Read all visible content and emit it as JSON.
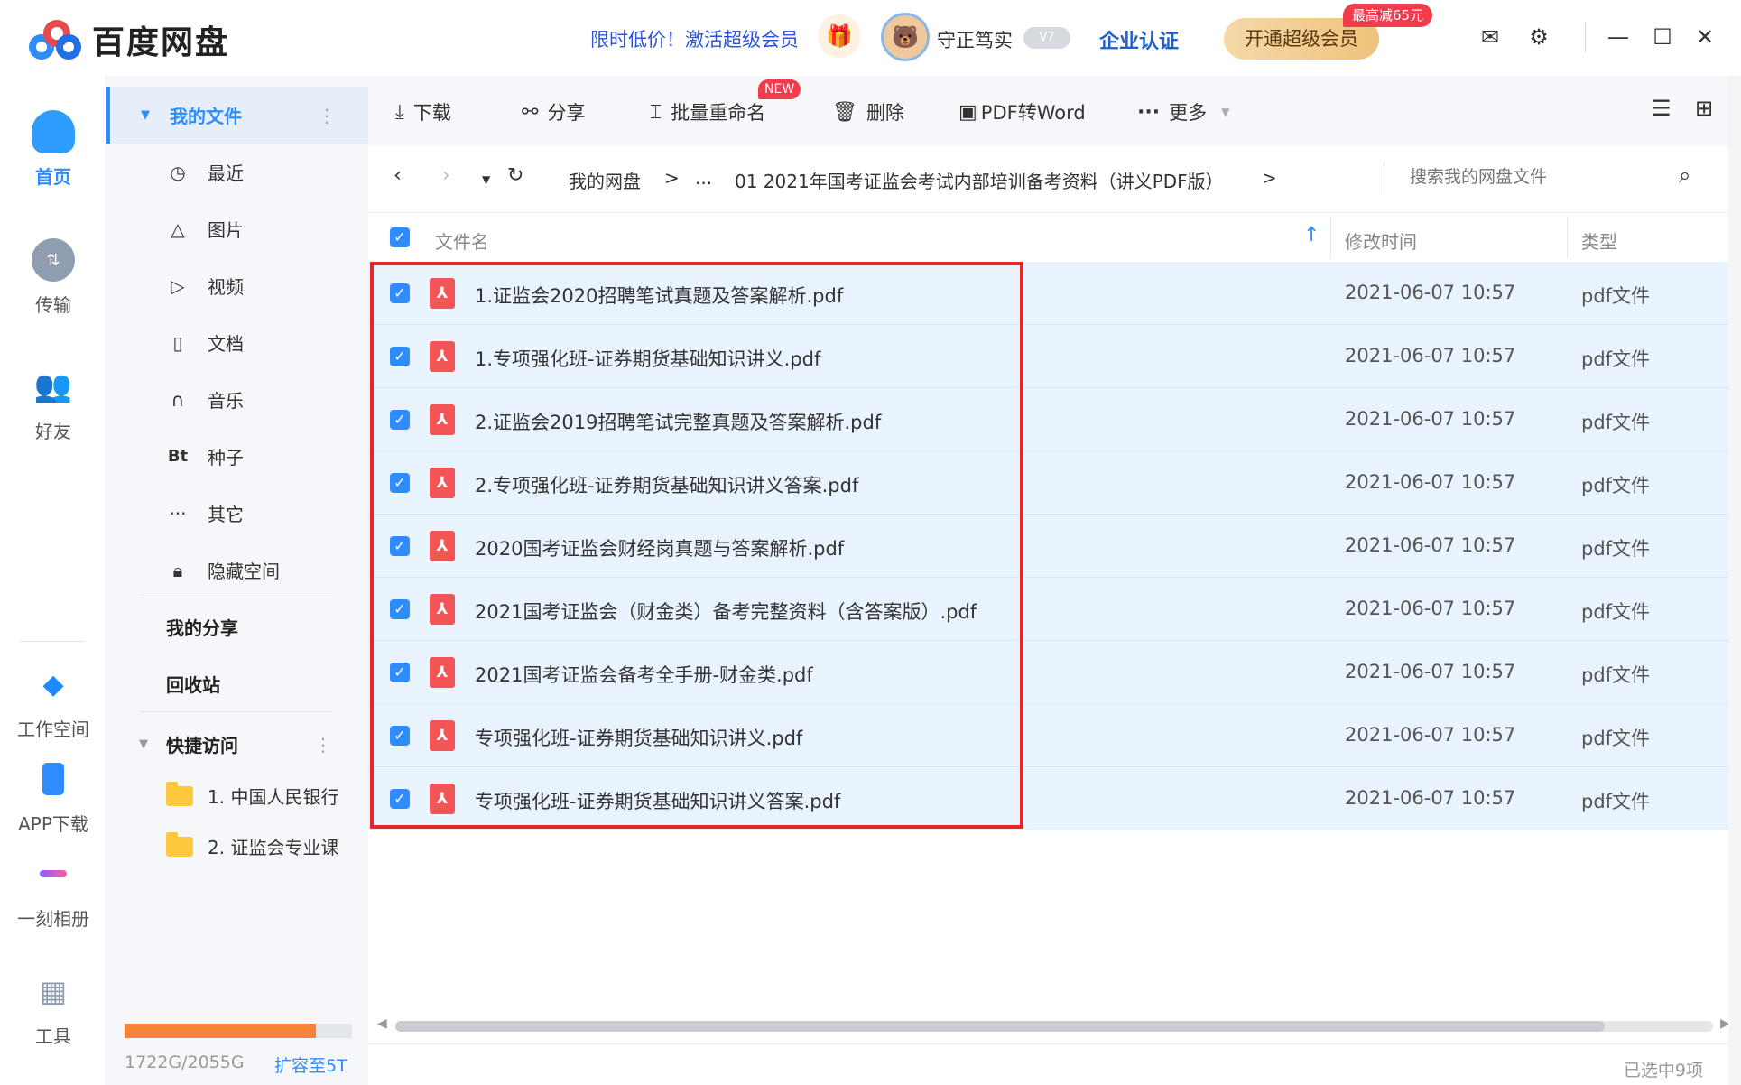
{
  "app": {
    "name": "百度网盘",
    "promo": "限时低价！激活超级会员",
    "username": "守正笃实",
    "vip_level": "V7",
    "enterprise": "企业认证",
    "vip_button": "开通超级会员",
    "discount": "最高减65元"
  },
  "leftnav": {
    "home": "首页",
    "transfer": "传输",
    "friends": "好友",
    "workspace": "工作空间",
    "app_download": "APP下载",
    "moment_album": "一刻相册",
    "tools": "工具"
  },
  "sidebar": {
    "my_files": "我的文件",
    "categories": [
      {
        "icon": "clock",
        "label": "最近"
      },
      {
        "icon": "image",
        "label": "图片"
      },
      {
        "icon": "play",
        "label": "视频"
      },
      {
        "icon": "document",
        "label": "文档"
      },
      {
        "icon": "headphones",
        "label": "音乐"
      },
      {
        "icon": "bt",
        "label": "种子"
      },
      {
        "icon": "ellipsis",
        "label": "其它"
      },
      {
        "icon": "lock",
        "label": "隐藏空间"
      }
    ],
    "my_share": "我的分享",
    "recycle": "回收站",
    "quick_access": "快捷访问",
    "quick_folders": [
      "1. 中国人民银行",
      "2. 证监会专业课"
    ],
    "storage_used": "1722G/2055G",
    "storage_ratio": 0.84,
    "expand": "扩容至5T"
  },
  "toolbar": {
    "download": "下载",
    "share": "分享",
    "batch_rename": "批量重命名",
    "new_badge": "NEW",
    "delete": "删除",
    "pdf_to_word": "PDF转Word",
    "more": "更多"
  },
  "navbar": {
    "crumb_root": "我的网盘",
    "crumb_sep": ">",
    "crumb_ellipsis": "...",
    "crumb_current": "01 2021年国考证监会考试内部培训备考资料（讲义PDF版）",
    "search_placeholder": "搜索我的网盘文件"
  },
  "table": {
    "col_name": "文件名",
    "col_modified": "修改时间",
    "col_type": "类型",
    "rows": [
      {
        "name": "1.证监会2020招聘笔试真题及答案解析.pdf",
        "modified": "2021-06-07 10:57",
        "type": "pdf文件"
      },
      {
        "name": "1.专项强化班-证券期货基础知识讲义.pdf",
        "modified": "2021-06-07 10:57",
        "type": "pdf文件"
      },
      {
        "name": "2.证监会2019招聘笔试完整真题及答案解析.pdf",
        "modified": "2021-06-07 10:57",
        "type": "pdf文件"
      },
      {
        "name": "2.专项强化班-证券期货基础知识讲义答案.pdf",
        "modified": "2021-06-07 10:57",
        "type": "pdf文件"
      },
      {
        "name": "2020国考证监会财经岗真题与答案解析.pdf",
        "modified": "2021-06-07 10:57",
        "type": "pdf文件"
      },
      {
        "name": "2021国考证监会（财金类）备考完整资料（含答案版）.pdf",
        "modified": "2021-06-07 10:57",
        "type": "pdf文件"
      },
      {
        "name": "2021国考证监会备考全手册-财金类.pdf",
        "modified": "2021-06-07 10:57",
        "type": "pdf文件"
      },
      {
        "name": "专项强化班-证券期货基础知识讲义.pdf",
        "modified": "2021-06-07 10:57",
        "type": "pdf文件"
      },
      {
        "name": "专项强化班-证券期货基础知识讲义答案.pdf",
        "modified": "2021-06-07 10:57",
        "type": "pdf文件"
      }
    ]
  },
  "status": {
    "selected": "已选中9项"
  },
  "colors": {
    "accent": "#2f8cff",
    "selection_bg": "#e9f3fd",
    "highlight_border": "#e8262a",
    "pdf_icon": "#f25555"
  }
}
